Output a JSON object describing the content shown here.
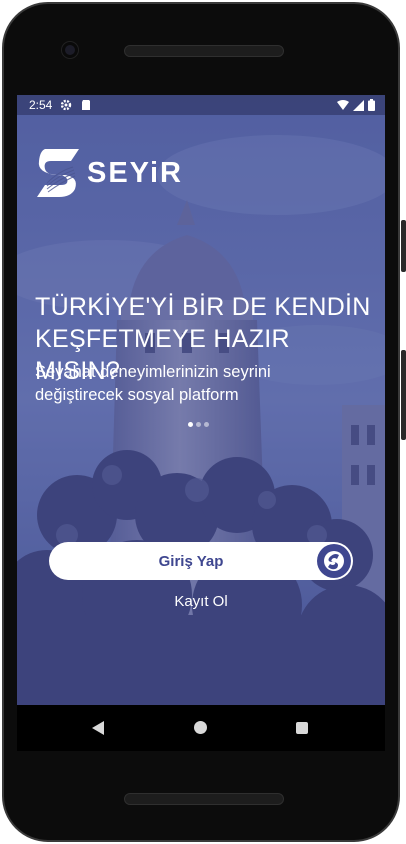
{
  "status": {
    "time": "2:54"
  },
  "brand": {
    "name": "SEYiR",
    "primary_color": "#3f4790"
  },
  "hero": {
    "headline_line1": "TÜRKİYE'Yİ BİR DE KENDİN",
    "headline_line2": "KEŞFETMEYE HAZIR MISIN?",
    "subtitle_line1": "Seyahat deneyimlerinizin seyrini",
    "subtitle_line2": "değiştirecek sosyal platform"
  },
  "carousel": {
    "current": 1,
    "total": 3
  },
  "actions": {
    "login_label": "Giriş Yap",
    "register_label": "Kayıt Ol"
  }
}
